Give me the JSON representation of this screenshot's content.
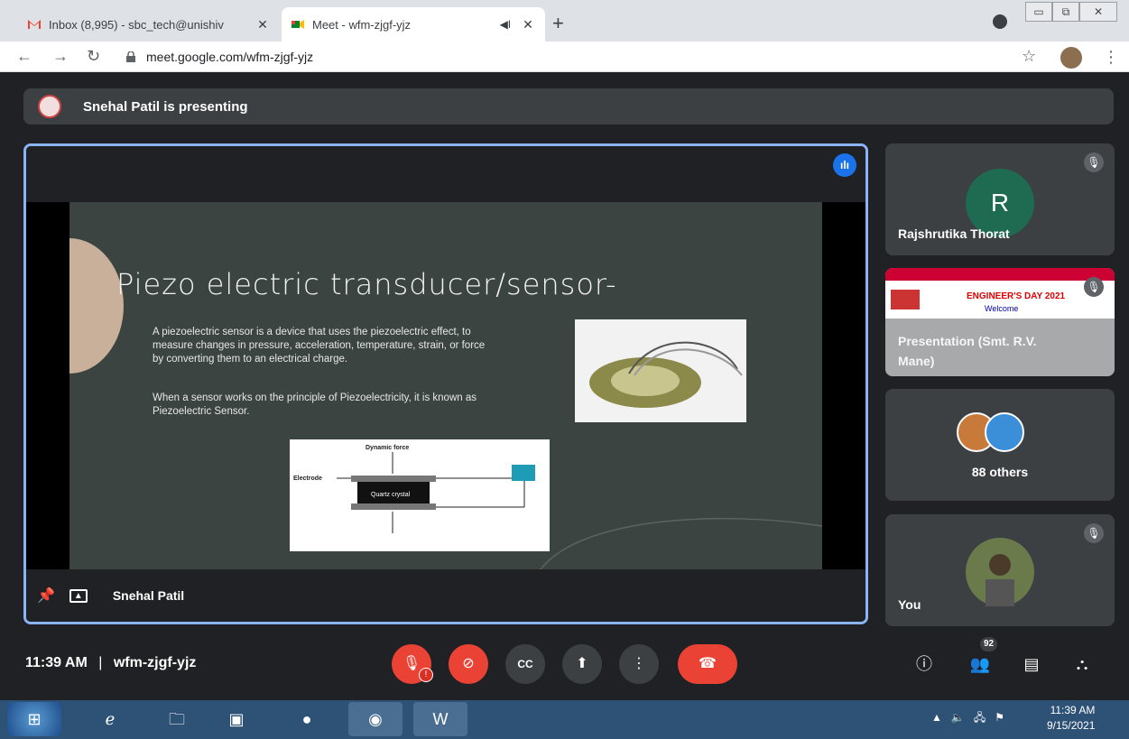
{
  "browser": {
    "tabs": [
      {
        "title": "Inbox (8,995) - sbc_tech@unishiv",
        "icon": "gmail-icon"
      },
      {
        "title": "Meet - wfm-zjgf-yjz",
        "icon": "meet-icon"
      }
    ],
    "url": "meet.google.com/wfm-zjgf-yjz"
  },
  "meeting": {
    "presenting_banner": "Snehal Patil is presenting",
    "presenter_name": "Snehal Patil",
    "time": "11:39 AM",
    "meeting_code": "wfm-zjgf-yjz",
    "participant_count": "92"
  },
  "slide": {
    "title": "Piezo electric transducer/sensor-",
    "paragraph1": "A piezoelectric sensor is a device that uses the piezoelectric effect, to measure changes in pressure, acceleration, temperature, strain, or force by converting them to an electrical charge.",
    "paragraph2": "When a sensor works on the principle of Piezoelectricity, it is known as Piezoelectric Sensor.",
    "diagram": {
      "top_label": "Dynamic force",
      "left_label": "Electrode",
      "crystal_label": "Quartz crystal"
    }
  },
  "participants": [
    {
      "name": "Rajshrutika Thorat",
      "initial": "R",
      "avatar_color": "#1e6b52"
    },
    {
      "name": "Presentation (Smt. R.V. Mane)",
      "thumb_title": "ENGINEER'S DAY 2021",
      "thumb_text": "Welcome"
    },
    {
      "name": "88 others"
    },
    {
      "name": "You"
    }
  ],
  "taskbar": {
    "clock_time": "11:39 AM",
    "clock_date": "9/15/2021"
  }
}
